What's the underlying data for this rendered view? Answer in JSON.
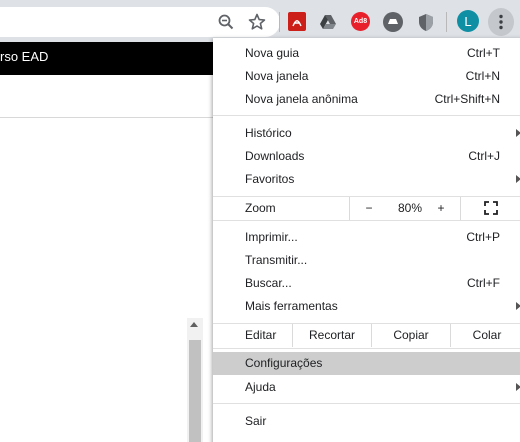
{
  "page": {
    "banner_text": "rso EAD"
  },
  "toolbar": {
    "icons": [
      "zoom-icon",
      "bookmark-star-icon",
      "pdf-extension-icon",
      "drive-extension-icon",
      "adblock-extension-icon",
      "hat-extension-icon",
      "shield-extension-icon",
      "profile-avatar",
      "chrome-menu-icon"
    ],
    "profile_initial": "L",
    "adblock_label": "Ad8",
    "colors": {
      "profile": "#0f8fa3",
      "adblock": "#e8202b",
      "pdf": "#cc1f1a"
    }
  },
  "menu": {
    "items_top": [
      {
        "label": "Nova guia",
        "shortcut": "Ctrl+T"
      },
      {
        "label": "Nova janela",
        "shortcut": "Ctrl+N"
      },
      {
        "label": "Nova janela anônima",
        "shortcut": "Ctrl+Shift+N"
      }
    ],
    "items_history": [
      {
        "label": "Histórico",
        "shortcut": ""
      },
      {
        "label": "Downloads",
        "shortcut": "Ctrl+J"
      },
      {
        "label": "Favoritos",
        "shortcut": ""
      }
    ],
    "zoom": {
      "label": "Zoom",
      "minus": "−",
      "value": "80%",
      "plus": "+"
    },
    "items_tools": [
      {
        "label": "Imprimir...",
        "shortcut": "Ctrl+P"
      },
      {
        "label": "Transmitir...",
        "shortcut": ""
      },
      {
        "label": "Buscar...",
        "shortcut": "Ctrl+F"
      },
      {
        "label": "Mais ferramentas",
        "shortcut": ""
      }
    ],
    "edit": {
      "label": "Editar",
      "cut": "Recortar",
      "copy": "Copiar",
      "paste": "Colar"
    },
    "items_settings": [
      {
        "label": "Configurações",
        "highlighted": true
      },
      {
        "label": "Ajuda"
      }
    ],
    "exit": {
      "label": "Sair"
    },
    "highlight_color": "#cdcdcd"
  }
}
